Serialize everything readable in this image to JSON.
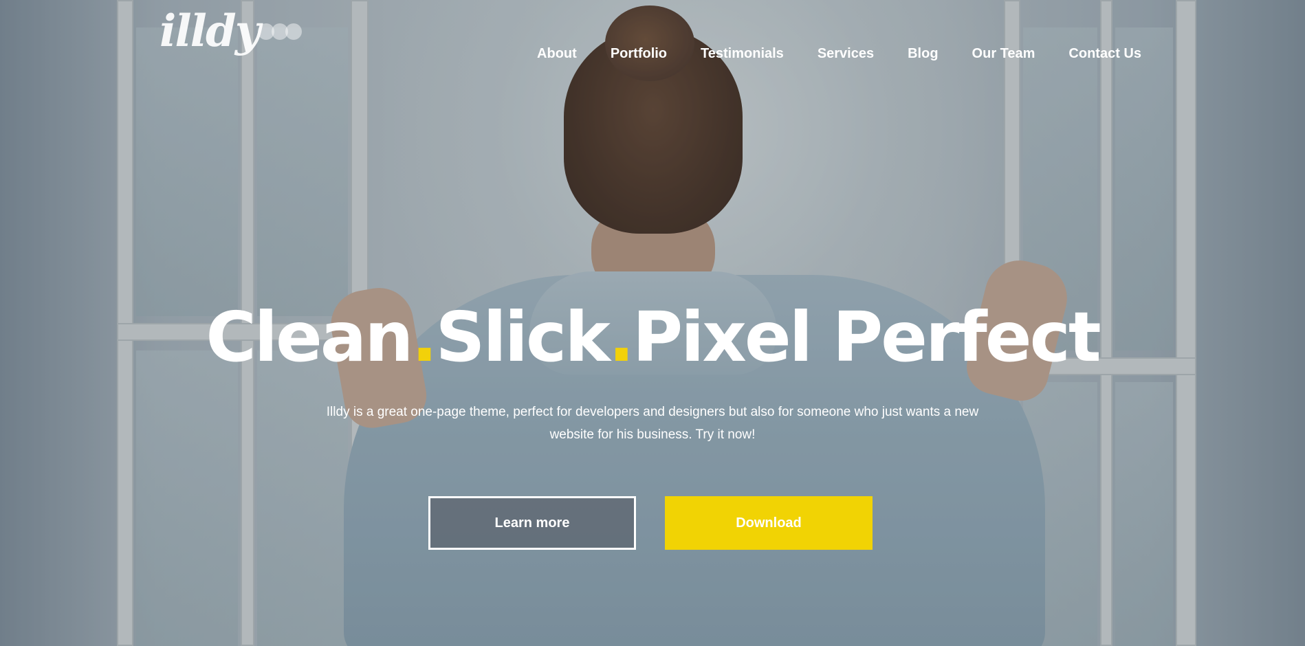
{
  "logo": {
    "text": "illdy"
  },
  "nav": {
    "items": [
      "About",
      "Portfolio",
      "Testimonials",
      "Services",
      "Blog",
      "Our Team",
      "Contact Us"
    ]
  },
  "hero": {
    "headline": {
      "word1": "Clean",
      "word2": "Slick",
      "word3": "Pixel Perfect",
      "separator": "."
    },
    "subtitle": "Illdy is a great one-page theme, perfect for developers and designers but also for someone who just wants a new website for his business. Try it now!",
    "buttons": {
      "learn_more": "Learn more",
      "download": "Download"
    }
  },
  "colors": {
    "accent": "#f1d304",
    "text": "#ffffff",
    "outline_button_bg": "#50545c"
  }
}
